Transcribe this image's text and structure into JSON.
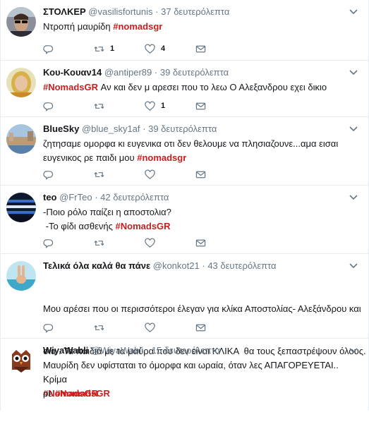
{
  "tweets": [
    {
      "name": "ΣΤΟΛΚΕΡ",
      "handle": "@vasilisfortunis",
      "time": "37 δευτερόλεπτα",
      "text_parts": [
        "Ντροπή μαυρίδη ",
        "#nomadsgr"
      ],
      "replies": "",
      "retweets": "1",
      "likes": "4",
      "avatar": "man-sunglasses-avatar"
    },
    {
      "name": "Κου-Κουαν14",
      "handle": "@antiper89",
      "time": "39 δευτερόλεπτα",
      "text_parts": [
        "#NomadsGR",
        " Αν και δεν μ αρεσει που το λεω Ο Αλεξανδρου εχει δικιο"
      ],
      "replies": "",
      "retweets": "",
      "likes": "1",
      "avatar": "woman-blonde-avatar"
    },
    {
      "name": "BlueSky",
      "handle": "@blue_sky1af",
      "time": "39 δευτερόλεπτα",
      "text_line1": "ζητησαμε ομορφα κι ευγενικα οτι δεν θελουμε να πλησιαζουνε...αμα εισαι",
      "text_line2_plain": "ευγενικος ρε παιδι μου ",
      "text_line2_tag": "#nomadsgr",
      "replies": "",
      "retweets": "",
      "likes": "",
      "avatar": "venice-canal-avatar"
    },
    {
      "name": "teo",
      "handle": "@FrTeo",
      "time": "42 δευτερόλεπτα",
      "text_line1": "-Ποιο ρόλο παίζει η αποστολια?",
      "text_line2_plain": " -Το φίδι ασθενής ",
      "text_line2_tag": "#NomadsGR",
      "replies": "",
      "retweets": "",
      "likes": "",
      "avatar": "greek-flag-avatar"
    },
    {
      "name": "Τελικά όλα καλά θα πάνε",
      "handle": "@konkot21",
      "time": "43 δευτερόλεπτα",
      "text_line1": "Μου αρέσει που οι περισσότεροι έλεγαν για κλίκα Αποστολίας- Αλεξάνδρου και",
      "text_line2": "σια . Τα παιδιά με τα μαύρα που δεν είναι ΚΛΙΚΑ  θα τους ξεπαστρέψουν όλους.",
      "text_line3_tag": "#NomadsGR",
      "replies": "",
      "retweets": "",
      "likes": "",
      "avatar": "peace-hand-avatar"
    },
    {
      "name": "WiyaWabli",
      "handle": "@WiyaWabli",
      "time": "15 δευτερόλεπτα",
      "text_line1": "Μαυρίδη δεν υφίσταται το όμορφα και ωραία, όταν λες ΑΠΑΓΟΡΕΥΕΤΑΙ.. Κρίμα",
      "text_line2_plain": "ρε ",
      "text_line2_tag": "#NomadsGR",
      "replies": "",
      "retweets": "",
      "likes": "",
      "avatar": "owl-avatar"
    }
  ],
  "colors": {
    "hashtag": "#c81e1e",
    "icon": "#657786",
    "text": "#14171a",
    "divider": "#e6ecf0"
  }
}
